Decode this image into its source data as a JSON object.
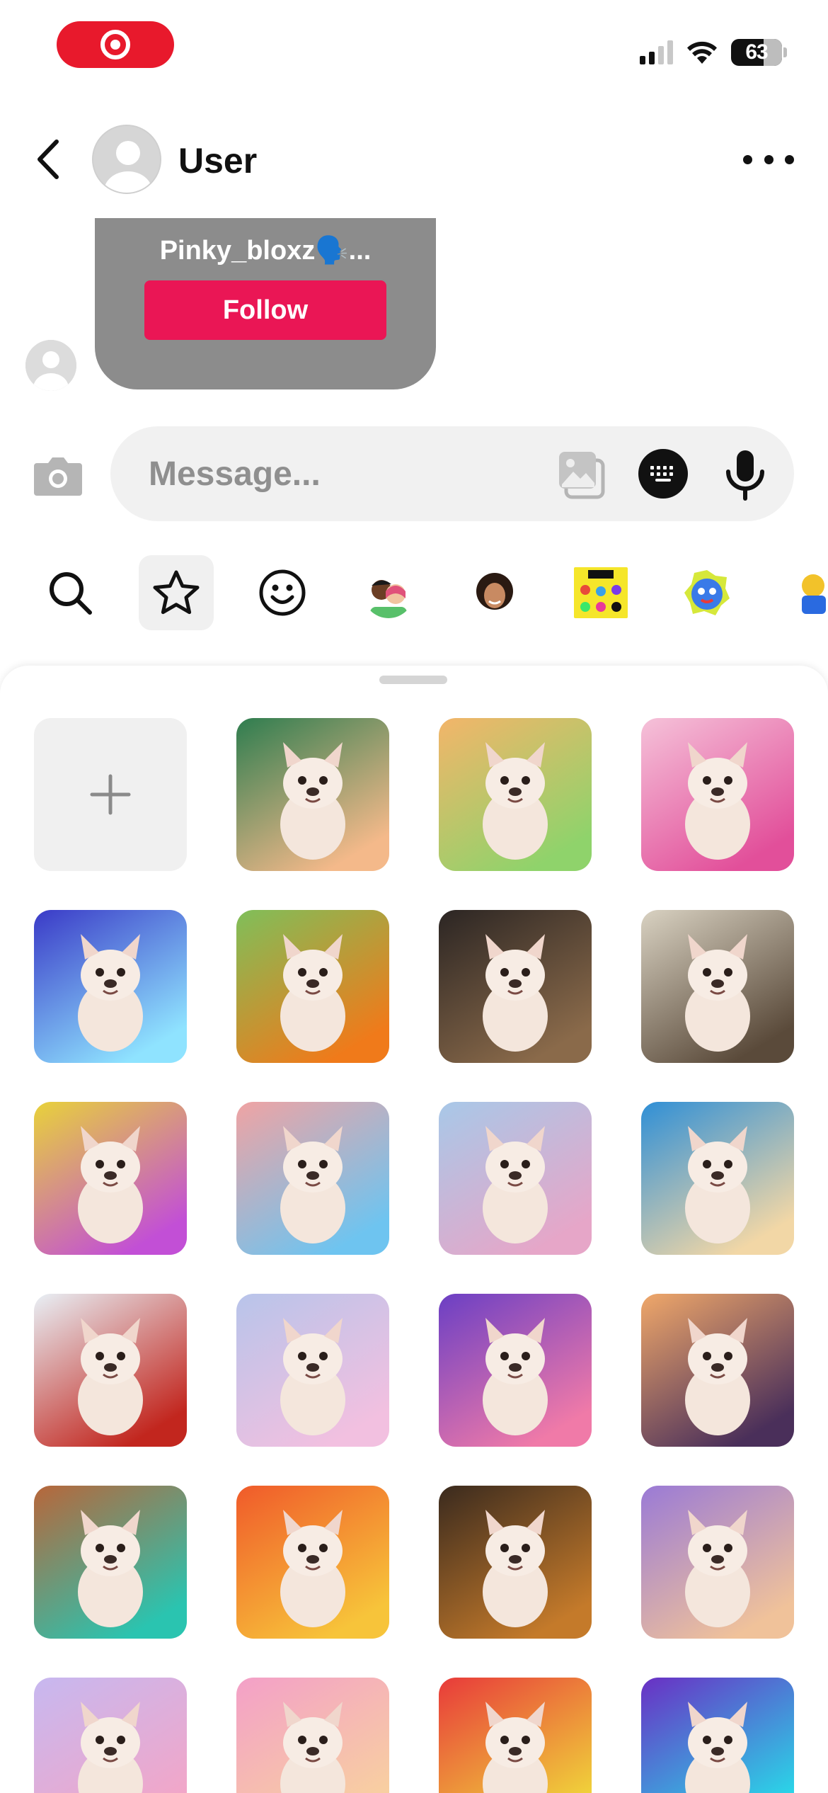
{
  "status_bar": {
    "battery": "63",
    "icons": [
      "record-icon",
      "signal-icon",
      "wifi-icon",
      "battery-icon"
    ]
  },
  "header": {
    "title": "User",
    "icons": [
      "back-icon",
      "avatar",
      "more-icon"
    ]
  },
  "profile_card": {
    "username": "Pinky_bloxz🗣️...",
    "follow_label": "Follow",
    "background": "#8c8c8c",
    "button_color": "#ea1655"
  },
  "composer": {
    "placeholder": "Message...",
    "icons": [
      "camera-icon",
      "gallery-icon",
      "keyboard-icon",
      "microphone-icon"
    ]
  },
  "sticker_tabs": [
    "search-icon",
    "star-icon",
    "smiley-icon",
    "avatar-pack",
    "avatar-portrait",
    "sticker-pack-yellow",
    "sticker-pack-blue",
    "sticker-pack-partial"
  ],
  "stickers": [
    {
      "name": "add-sticker",
      "colors": [
        "#f0f0f0",
        "#f0f0f0"
      ]
    },
    {
      "name": "dancing-puppy-green",
      "colors": [
        "#2e7d4f",
        "#f4b98a"
      ]
    },
    {
      "name": "bunny-ears-puppy",
      "colors": [
        "#f3b56a",
        "#8fd36b"
      ]
    },
    {
      "name": "pink-bedroom-puppy",
      "colors": [
        "#f5c2d9",
        "#e24f9a"
      ]
    },
    {
      "name": "ice-princess-puppy",
      "colors": [
        "#3a3ac7",
        "#8fe3ff"
      ]
    },
    {
      "name": "goku-puppy",
      "colors": [
        "#7fbf5a",
        "#f07a1a"
      ]
    },
    {
      "name": "rainy-street-pups",
      "colors": [
        "#2b2523",
        "#8a6a4a"
      ]
    },
    {
      "name": "grocery-puppy",
      "colors": [
        "#d9d2c2",
        "#5a4a3a"
      ]
    },
    {
      "name": "banana-dance-pups",
      "colors": [
        "#e8d23a",
        "#c24fd6"
      ]
    },
    {
      "name": "rainbow-cool-puppy",
      "colors": [
        "#f0a3a3",
        "#6ec4f0"
      ]
    },
    {
      "name": "fountain-pups",
      "colors": [
        "#a8c8e8",
        "#e6a6c8"
      ]
    },
    {
      "name": "beach-dolphin-puppy",
      "colors": [
        "#2f8fd6",
        "#f2d7a6"
      ]
    },
    {
      "name": "bee-puppy",
      "colors": [
        "#e8f0f6",
        "#c2261e"
      ]
    },
    {
      "name": "unicorn-puppy",
      "colors": [
        "#b8c4ea",
        "#f2c0e0"
      ]
    },
    {
      "name": "rose-puppy",
      "colors": [
        "#6b3fc4",
        "#f07aa8"
      ]
    },
    {
      "name": "sunset-puppy",
      "colors": [
        "#f0a86a",
        "#4a2f5a"
      ]
    },
    {
      "name": "deck-puppy",
      "colors": [
        "#b8663a",
        "#2ac4b0"
      ]
    },
    {
      "name": "fries-puppy",
      "colors": [
        "#f05a2a",
        "#f7c43a"
      ]
    },
    {
      "name": "cowboy-pups",
      "colors": [
        "#3a2a1e",
        "#c47a2a"
      ]
    },
    {
      "name": "castle-puppy",
      "colors": [
        "#9a7ad6",
        "#f0c29a"
      ]
    },
    {
      "name": "rainbow-sky-puppy",
      "colors": [
        "#c7b8f0",
        "#f2a6c8"
      ]
    },
    {
      "name": "bow-puppy",
      "colors": [
        "#f3a0c8",
        "#f8d0a0"
      ]
    },
    {
      "name": "balloon-puppy",
      "colors": [
        "#e83a3a",
        "#f0d23a"
      ]
    },
    {
      "name": "headphones-puppy",
      "colors": [
        "#6a2fc4",
        "#2ad6e8"
      ]
    }
  ]
}
